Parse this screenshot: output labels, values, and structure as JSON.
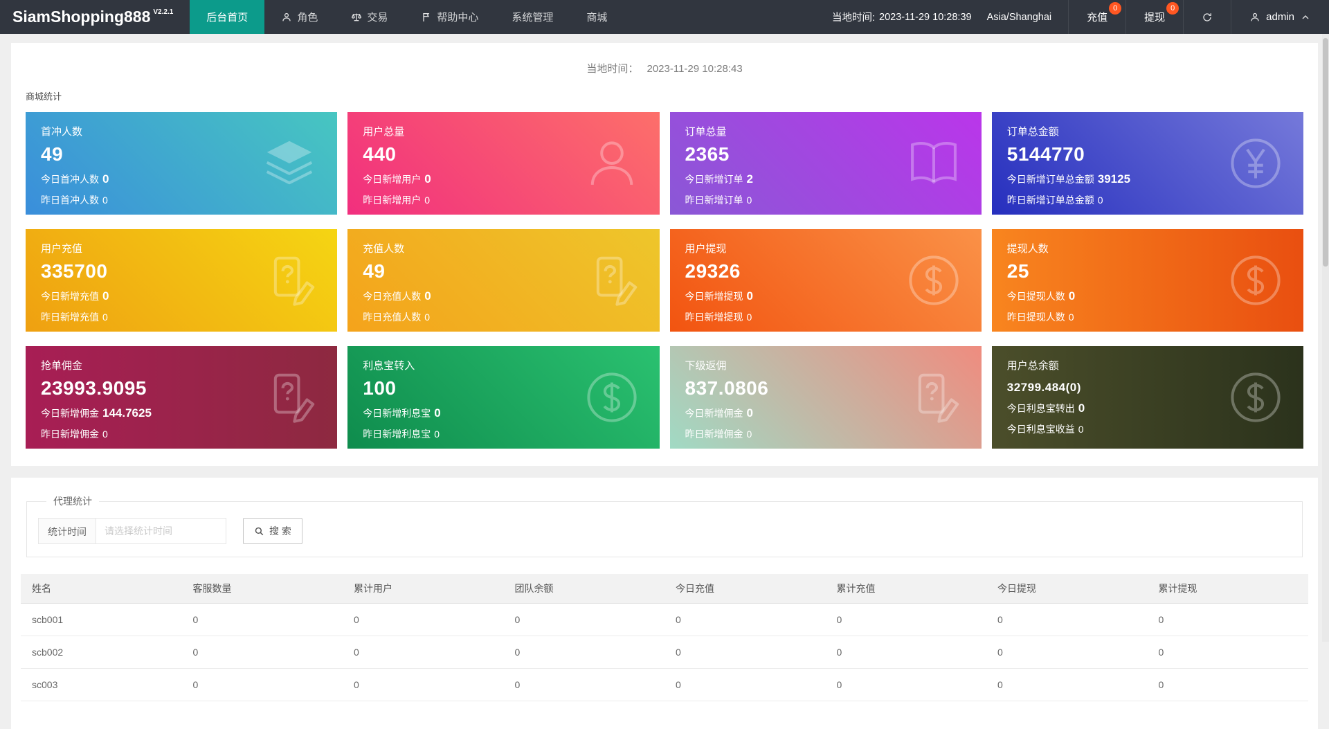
{
  "colors": {
    "navbar_bg": "#31363f",
    "accent_teal": "#0c9b8b",
    "badge": "#ff5722",
    "page_bg": "#efefef"
  },
  "navbar": {
    "brand": "SiamShopping888",
    "version": "V2.2.1",
    "menu": [
      {
        "key": "home",
        "label": "后台首页",
        "icon": null,
        "active": true
      },
      {
        "key": "roles",
        "label": "角色",
        "icon": "user-icon",
        "active": false
      },
      {
        "key": "trade",
        "label": "交易",
        "icon": "scales-icon",
        "active": false
      },
      {
        "key": "help-center",
        "label": "帮助中心",
        "icon": "flag-icon",
        "active": false
      },
      {
        "key": "system",
        "label": "系统管理",
        "icon": null,
        "active": false
      },
      {
        "key": "mall",
        "label": "商城",
        "icon": null,
        "active": false
      }
    ],
    "local_time_label": "当地时间:",
    "local_time": "2023-11-29 10:28:39",
    "timezone": "Asia/Shanghai",
    "recharge": {
      "label": "充值",
      "badge": "0"
    },
    "withdraw": {
      "label": "提现",
      "badge": "0"
    },
    "user": "admin"
  },
  "overview": {
    "time_label": "当地时间：",
    "time_value": "2023-11-29 10:28:43",
    "section_title": "商城统计",
    "cards": [
      {
        "key": "first-recharge-users",
        "title": "首冲人数",
        "value": "49",
        "value_small": false,
        "icon": "layers-icon",
        "gradient": {
          "angle": "45deg",
          "from": "#3a8edb",
          "to": "#47c6c1"
        },
        "lines": [
          {
            "label": "今日首冲人数",
            "value": "0",
            "bold": true
          },
          {
            "label": "昨日首冲人数",
            "value": "0",
            "bold": false
          }
        ]
      },
      {
        "key": "total-users",
        "title": "用户总量",
        "value": "440",
        "value_small": false,
        "icon": "person-icon",
        "gradient": {
          "angle": "45deg",
          "from": "#f12f7e",
          "to": "#fd6f6a"
        },
        "lines": [
          {
            "label": "今日新增用户",
            "value": "0",
            "bold": true
          },
          {
            "label": "昨日新增用户",
            "value": "0",
            "bold": false
          }
        ]
      },
      {
        "key": "total-orders",
        "title": "订单总量",
        "value": "2365",
        "value_small": false,
        "icon": "book-icon",
        "gradient": {
          "angle": "45deg",
          "from": "#8a58d6",
          "to": "#ba36ea"
        },
        "lines": [
          {
            "label": "今日新增订单",
            "value": "2",
            "bold": true
          },
          {
            "label": "昨日新增订单",
            "value": "0",
            "bold": false
          }
        ]
      },
      {
        "key": "order-amount",
        "title": "订单总金额",
        "value": "5144770",
        "value_small": false,
        "icon": "yen-circle-icon",
        "gradient": {
          "angle": "45deg",
          "from": "#262fbe",
          "to": "#7579da"
        },
        "lines": [
          {
            "label": "今日新增订单总金额",
            "value": "39125",
            "bold": true
          },
          {
            "label": "昨日新增订单总金额",
            "value": "0",
            "bold": false
          }
        ]
      },
      {
        "key": "user-recharge",
        "title": "用户充值",
        "value": "335700",
        "value_small": false,
        "icon": "contract-edit-icon",
        "gradient": {
          "angle": "45deg",
          "from": "#efa011",
          "to": "#f5d513"
        },
        "lines": [
          {
            "label": "今日新增充值",
            "value": "0",
            "bold": true
          },
          {
            "label": "昨日新增充值",
            "value": "0",
            "bold": false
          }
        ]
      },
      {
        "key": "recharge-users",
        "title": "充值人数",
        "value": "49",
        "value_small": false,
        "icon": "contract-edit-icon",
        "gradient": {
          "angle": "45deg",
          "from": "#f4a31b",
          "to": "#eec62b"
        },
        "lines": [
          {
            "label": "今日充值人数",
            "value": "0",
            "bold": true
          },
          {
            "label": "昨日充值人数",
            "value": "0",
            "bold": false
          }
        ]
      },
      {
        "key": "user-withdraw",
        "title": "用户提现",
        "value": "29326",
        "value_small": false,
        "icon": "dollar-circle-icon",
        "gradient": {
          "angle": "45deg",
          "from": "#f25410",
          "to": "#fa9147"
        },
        "lines": [
          {
            "label": "今日新增提现",
            "value": "0",
            "bold": true
          },
          {
            "label": "昨日新增提现",
            "value": "0",
            "bold": false
          }
        ]
      },
      {
        "key": "withdraw-users",
        "title": "提现人数",
        "value": "25",
        "value_small": false,
        "icon": "dollar-circle-icon",
        "gradient": {
          "angle": "90deg",
          "from": "#f8851f",
          "to": "#e94f10"
        },
        "lines": [
          {
            "label": "今日提现人数",
            "value": "0",
            "bold": true
          },
          {
            "label": "昨日提现人数",
            "value": "0",
            "bold": false
          }
        ]
      },
      {
        "key": "order-commission",
        "title": "抢单佣金",
        "value": "23993.9095",
        "value_small": false,
        "icon": "contract-edit-icon",
        "gradient": {
          "angle": "90deg",
          "from": "#a81e55",
          "to": "#8d2940"
        },
        "lines": [
          {
            "label": "今日新增佣金",
            "value": "144.7625",
            "bold": true
          },
          {
            "label": "昨日新增佣金",
            "value": "0",
            "bold": false
          }
        ]
      },
      {
        "key": "interest-transfer-in",
        "title": "利息宝转入",
        "value": "100",
        "value_small": false,
        "icon": "dollar-circle-icon",
        "gradient": {
          "angle": "45deg",
          "from": "#0f8c4d",
          "to": "#2ac170"
        },
        "lines": [
          {
            "label": "今日新增利息宝",
            "value": "0",
            "bold": true
          },
          {
            "label": "昨日新增利息宝",
            "value": "0",
            "bold": false
          }
        ]
      },
      {
        "key": "sub-rebate",
        "title": "下级返佣",
        "value": "837.0806",
        "value_small": false,
        "icon": "contract-edit-icon",
        "gradient": {
          "angle": "45deg",
          "from": "#a0dac4",
          "to": "#ef8c7f"
        },
        "lines": [
          {
            "label": "今日新增佣金",
            "value": "0",
            "bold": true
          },
          {
            "label": "昨日新增佣金",
            "value": "0",
            "bold": false
          }
        ]
      },
      {
        "key": "user-total-balance",
        "title": "用户总余额",
        "value": "32799.484(0)",
        "value_small": true,
        "icon": "dollar-circle-icon",
        "gradient": {
          "angle": "90deg",
          "from": "#4b4e2a",
          "to": "#2b321c"
        },
        "lines": [
          {
            "label": "今日利息宝转出",
            "value": "0",
            "bold": true
          },
          {
            "label": "今日利息宝收益",
            "value": "0",
            "bold": false
          }
        ]
      }
    ]
  },
  "agent": {
    "legend": "代理统计",
    "filter_label": "统计时间",
    "filter_placeholder": "请选择统计时间",
    "search_label": "搜 索",
    "table": {
      "headers": [
        "姓名",
        "客服数量",
        "累计用户",
        "团队余额",
        "今日充值",
        "累计充值",
        "今日提现",
        "累计提现"
      ],
      "rows": [
        [
          "scb001",
          "0",
          "0",
          "0",
          "0",
          "0",
          "0",
          "0"
        ],
        [
          "scb002",
          "0",
          "0",
          "0",
          "0",
          "0",
          "0",
          "0"
        ],
        [
          "sc003",
          "0",
          "0",
          "0",
          "0",
          "0",
          "0",
          "0"
        ]
      ]
    }
  }
}
